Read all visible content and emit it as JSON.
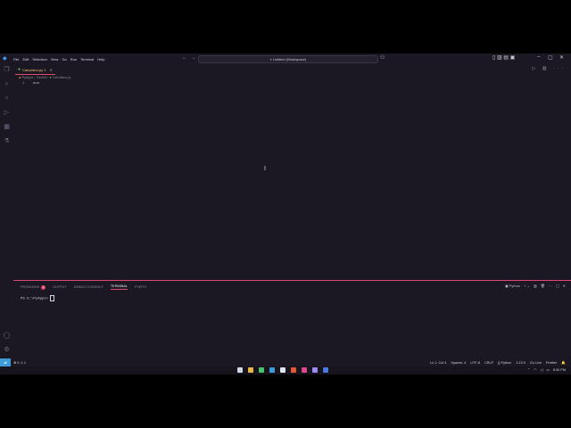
{
  "titlebar": {
    "menu": [
      "File",
      "Edit",
      "Selection",
      "View",
      "Go",
      "Run",
      "Terminal",
      "Help"
    ],
    "command_center": "Untitled (Workspace)"
  },
  "editor": {
    "tab_label": "Calculator.py 1",
    "breadcrumb": [
      "PyApps",
      "Tutorial",
      "Calculator.py"
    ],
    "line_number": "1",
    "code": "nun"
  },
  "panel": {
    "tabs": [
      "PROBLEMS",
      "OUTPUT",
      "DEBUG CONSOLE",
      "TERMINAL",
      "PORTS"
    ],
    "problems_count": "1",
    "active_tab": "TERMINAL",
    "terminal_kind": "Python",
    "terminal_prompt": "PS E:\\PyApps>"
  },
  "statusbar": {
    "left": "⊗ 0 ⚠ 1",
    "position": "Ln 1, Col 4",
    "spaces": "Spaces: 4",
    "encoding": "UTF-8",
    "eol": "CRLF",
    "language": "Python",
    "version": "3.13.9",
    "go_live": "Go Live",
    "prettier": "Prettier"
  },
  "taskbar": {
    "time": "8:30 PM"
  },
  "colors": {
    "accent": "#e04a6e",
    "background": "#1b1823",
    "remote": "#3f9bd6"
  }
}
